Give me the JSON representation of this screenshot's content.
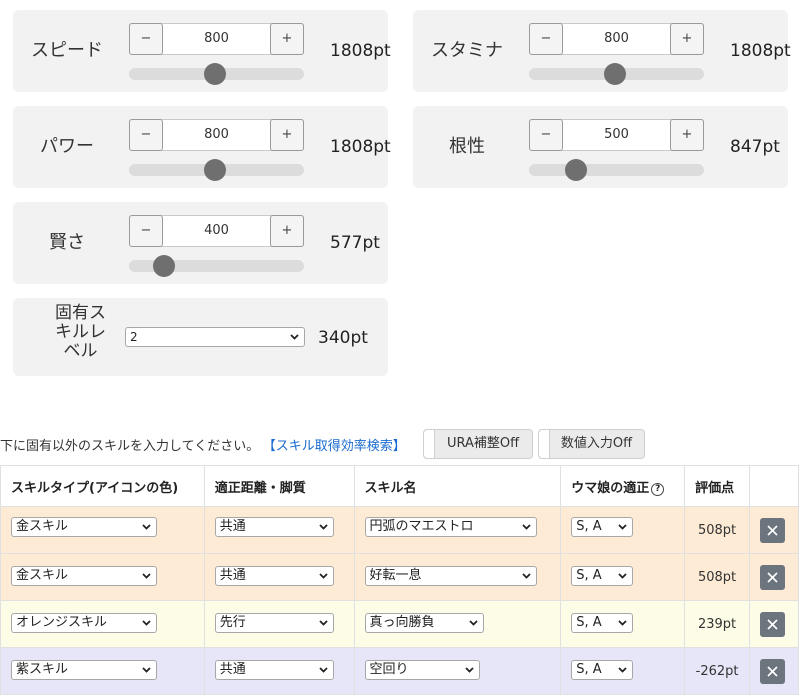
{
  "stats": [
    {
      "label": "スピード",
      "value": "800",
      "points": "1808pt",
      "level": 0.49
    },
    {
      "label": "スタミナ",
      "value": "800",
      "points": "1808pt",
      "level": 0.49
    },
    {
      "label": "パワー",
      "value": "800",
      "points": "1808pt",
      "level": 0.49
    },
    {
      "label": "根性",
      "value": "500",
      "points": "847pt",
      "level": 0.27
    },
    {
      "label": "賢さ",
      "value": "400",
      "points": "577pt",
      "level": 0.2
    }
  ],
  "stepper": {
    "minus_label": "−",
    "plus_label": "+"
  },
  "unique_skill": {
    "label_lines": [
      "固有ス",
      "キルレ",
      "ベル"
    ],
    "selected": "2",
    "points": "340pt"
  },
  "skill_section": {
    "hint": "下に固有以外のスキルを入力してください。",
    "search_link": "【スキル取得効率検索】",
    "ura_toggle": "URA補整Off",
    "numeric_toggle": "数値入力Off"
  },
  "table": {
    "headers": {
      "type": "スキルタイプ(アイコンの色)",
      "distance": "適正距離・脚質",
      "name": "スキル名",
      "aptitude": "ウマ娘の適正",
      "aptitude_help": "?",
      "score": "評価点"
    },
    "rows": [
      {
        "type": "金スキル",
        "distance": "共通",
        "name": "円弧のマエストロ",
        "aptitude": "S, A",
        "score": "508pt"
      },
      {
        "type": "金スキル",
        "distance": "共通",
        "name": "好転一息",
        "aptitude": "S, A",
        "score": "508pt"
      },
      {
        "type": "オレンジスキル",
        "distance": "先行",
        "name": "真っ向勝負",
        "aptitude": "S, A",
        "score": "239pt"
      },
      {
        "type": "紫スキル",
        "distance": "共通",
        "name": "空回り",
        "aptitude": "S, A",
        "score": "-262pt"
      }
    ]
  },
  "colors": {
    "gold_row": "#fdebd6",
    "orange_row": "#fdfce6",
    "purple_row": "#e6e6f8",
    "link": "#1a6bd0",
    "close_button": "#6c757d"
  }
}
